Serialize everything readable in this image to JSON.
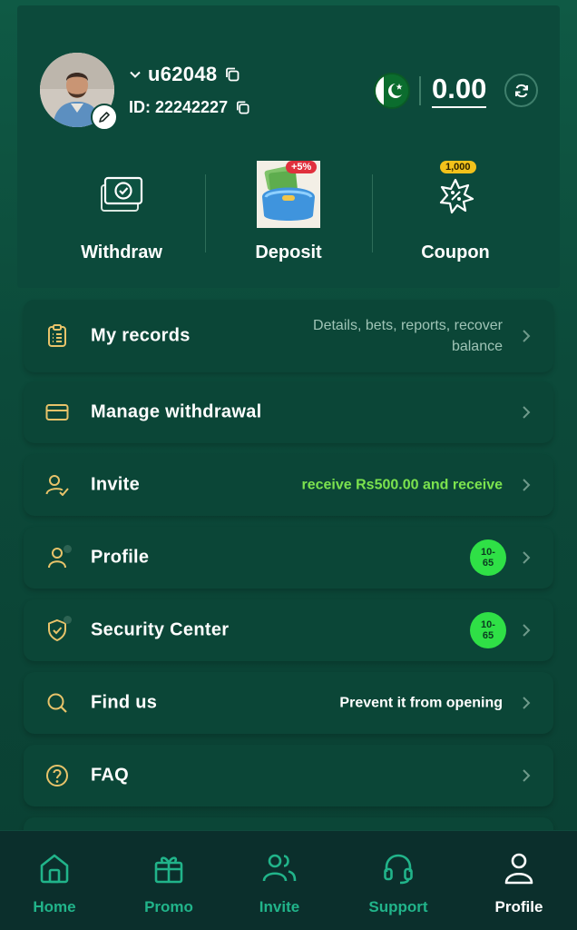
{
  "header": {
    "username": "u62048",
    "user_id": "ID: 22242227",
    "balance": "0.00",
    "currency_flag": "pakistan-flag-icon"
  },
  "actions": [
    {
      "label": "Withdraw",
      "icon": "withdraw-card-icon"
    },
    {
      "label": "Deposit",
      "icon": "wallet-icon",
      "badge": "+5%"
    },
    {
      "label": "Coupon",
      "icon": "coupon-icon",
      "badge": "1,000"
    }
  ],
  "menu": [
    {
      "label": "My records",
      "detail": "Details, bets, reports, recover balance",
      "icon": "clipboard-icon"
    },
    {
      "label": "Manage withdrawal",
      "detail": "",
      "icon": "card-icon"
    },
    {
      "label": "Invite",
      "detail": "receive Rs500.00 and receive",
      "icon": "user-check-icon"
    },
    {
      "label": "Profile",
      "detail": "10-\n65",
      "icon": "user-icon"
    },
    {
      "label": "Security Center",
      "detail": "10-\n65",
      "icon": "shield-icon"
    },
    {
      "label": "Find us",
      "detail": "Prevent it from opening",
      "icon": "search-icon"
    },
    {
      "label": "FAQ",
      "detail": "",
      "icon": "help-icon"
    }
  ],
  "nav": [
    {
      "label": "Home",
      "icon": "home-icon"
    },
    {
      "label": "Promo",
      "icon": "gift-icon"
    },
    {
      "label": "Invite",
      "icon": "users-icon"
    },
    {
      "label": "Support",
      "icon": "headset-icon"
    },
    {
      "label": "Profile",
      "icon": "profile-icon",
      "active": true
    }
  ],
  "colors": {
    "accent": "#21b48a",
    "gold_icon": "#e8c36a",
    "green_highlight": "#7ce34e",
    "badge_green": "#2fe046"
  }
}
